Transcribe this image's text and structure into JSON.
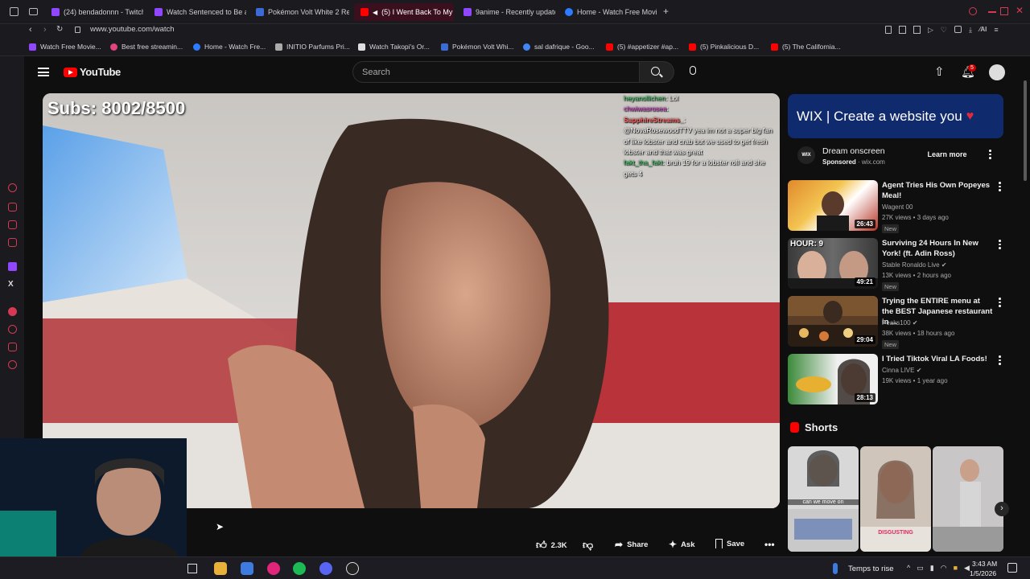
{
  "browser": {
    "tabs": [
      {
        "label": "(24) bendadonnn - Twitch",
        "color": "#9146ff"
      },
      {
        "label": "Watch Sentenced to Be a",
        "color": "#9146ff"
      },
      {
        "label": "Pokémon Volt White 2 Re",
        "color": "#3b6bd6"
      },
      {
        "label": "(5) I Went Back To My",
        "color": "#ff0000"
      },
      {
        "label": "9anime - Recently update",
        "color": "#9146ff"
      },
      {
        "label": "Home - Watch Free Movie",
        "color": "#2d7bff"
      }
    ],
    "new_tab_label": "+",
    "url": "www.youtube.com/watch",
    "bookmarks": [
      {
        "label": "Watch Free Movie...",
        "color": "#9146ff"
      },
      {
        "label": "Best free streamin...",
        "color": "#e0457b"
      },
      {
        "label": "Home - Watch Fre...",
        "color": "#2d7bff"
      },
      {
        "label": "INITIO Parfums Pri...",
        "color": "#aaaaaa"
      },
      {
        "label": "Watch Takopi's Or...",
        "color": "#dddddd"
      },
      {
        "label": "Pokémon Volt Whi...",
        "color": "#3b6bd6"
      },
      {
        "label": "sal dafrique - Goo...",
        "color": "#4285f4"
      },
      {
        "label": "(5) #appetizer #ap...",
        "color": "#ff0000"
      },
      {
        "label": "(5) Pinkalicious D...",
        "color": "#ff0000"
      },
      {
        "label": "(5) The California...",
        "color": "#ff0000"
      }
    ]
  },
  "youtube": {
    "logo_text": "YouTube",
    "search_placeholder": "Search",
    "notification_count": "5",
    "subs_overlay": "Subs: 8002/8500",
    "chat": [
      {
        "user": "heyanollichen",
        "msg": ": Lol"
      },
      {
        "user": "chwiwasrosea",
        "msg": ":"
      },
      {
        "user": "SapphireStreams_",
        "msg": ":"
      },
      {
        "user": "",
        "msg": "@NovaRosewoodTTV yea im not a super big fan of like lobster and crab but we used to get fresh lobster and that was great"
      },
      {
        "user": "fakt_tha_fakt",
        "msg": ": bruh 19 for a lobster roll and she gets 4"
      }
    ],
    "actions": {
      "like_count": "2.3K",
      "share": "Share",
      "ask": "Ask",
      "save": "Save"
    },
    "ad": {
      "banner": "WIX | Create a website you",
      "title": "Dream onscreen",
      "sponsored": "Sponsored",
      "domain": "wix.com",
      "cta": "Learn more"
    },
    "recommendations": [
      {
        "title": "Agent Tries His Own Popeyes Meal!",
        "channel": "Wagent 00",
        "meta": "27K views • 3 days ago",
        "badge": "New",
        "duration": "26:43",
        "verified": false
      },
      {
        "title": "Surviving 24 Hours In New York! (ft. Adin Ross)",
        "channel": "Stable Ronaldo Live",
        "meta": "13K views • 2 hours ago",
        "badge": "New",
        "duration": "49:21",
        "verified": true,
        "thumb_text": "HOUR: 9"
      },
      {
        "title": "Trying the ENTIRE menu at the BEST Japanese restaurant in ...",
        "channel": "Peaks100",
        "meta": "38K views • 18 hours ago",
        "badge": "New",
        "duration": "29:04",
        "verified": true
      },
      {
        "title": "I Tried Tiktok Viral LA Foods!",
        "channel": "Cinna LIVE",
        "meta": "19K views • 1 year ago",
        "badge": "",
        "duration": "28:13",
        "verified": true
      }
    ],
    "shorts_heading": "Shorts",
    "shorts": [
      {
        "caption": "can we move on"
      },
      {
        "caption": "DISGUSTING"
      },
      {
        "caption": ""
      }
    ]
  },
  "taskbar": {
    "weather": "Temps to rise",
    "time": "3:43 AM",
    "date": "1/5/2026"
  }
}
